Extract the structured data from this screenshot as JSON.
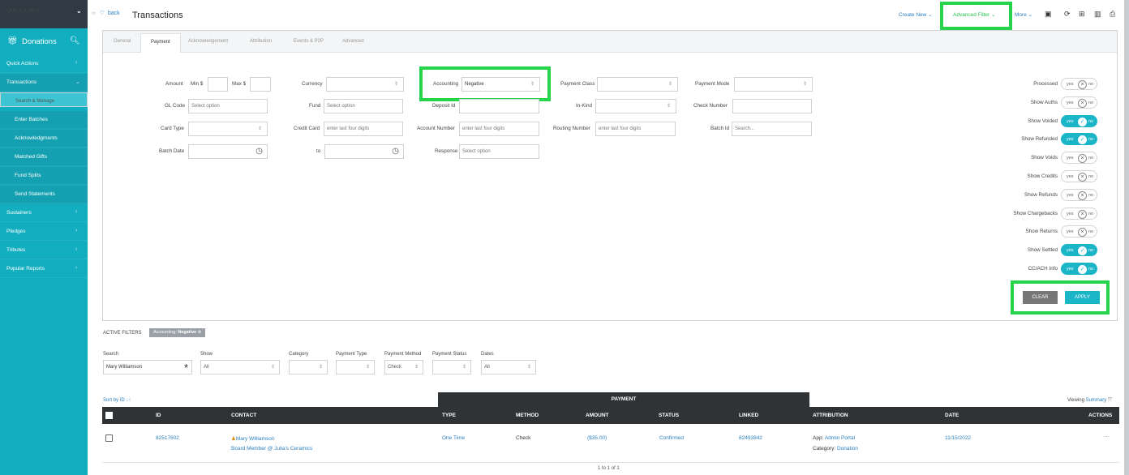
{
  "sidebar": {
    "quick_links": "QUICK LINKS",
    "section": "Donations",
    "items": [
      {
        "label": "Quick Actions",
        "chev": "›"
      },
      {
        "label": "Transactions",
        "chev": "⌄"
      },
      {
        "label": "Search & Manage"
      },
      {
        "label": "Enter Batches"
      },
      {
        "label": "Acknowledgments"
      },
      {
        "label": "Matched Gifts"
      },
      {
        "label": "Fund Splits"
      },
      {
        "label": "Send Statements"
      },
      {
        "label": "Sustainers",
        "chev": "›"
      },
      {
        "label": "Pledges",
        "chev": "›"
      },
      {
        "label": "Tributes",
        "chev": "›"
      },
      {
        "label": "Popular Reports",
        "chev": "›"
      }
    ]
  },
  "header": {
    "back": "back",
    "title": "Transactions",
    "create_new": "Create New ⌄",
    "advanced_filter": "Advanced Filter ⌄",
    "more": "More ⌄"
  },
  "tabs": [
    "General",
    "Payment",
    "Acknowledgement",
    "Attribution",
    "Events & P2P",
    "Advanced"
  ],
  "filters": {
    "amount": "Amount",
    "min": "Min $",
    "max": "Max $",
    "currency": "Currency",
    "accounting": "Accounting",
    "accounting_value": "Negative",
    "payment_class": "Payment Class",
    "payment_mode": "Payment Mode",
    "gl_code": "GL Code",
    "gl_code_ph": "Select option",
    "fund": "Fund",
    "fund_ph": "Select option",
    "deposit_id": "Deposit Id",
    "in_kind": "In-Kind",
    "check_number": "Check Number",
    "card_type": "Card Type",
    "credit_card": "Credit Card",
    "credit_card_ph": "enter last four digits",
    "account_number": "Account Number",
    "account_number_ph": "enter last four digits",
    "routing_number": "Routing Number",
    "routing_number_ph": "enter last four digits",
    "batch_id": "Batch Id",
    "batch_id_ph": "Search...",
    "batch_date": "Batch Date",
    "to": "to",
    "response": "Response",
    "response_ph": "Select option"
  },
  "toggles": [
    {
      "label": "Processed",
      "on": false
    },
    {
      "label": "Show Auths",
      "on": false
    },
    {
      "label": "Show Voided",
      "on": true
    },
    {
      "label": "Show Refunded",
      "on": true
    },
    {
      "label": "Show Voids",
      "on": false
    },
    {
      "label": "Show Credits",
      "on": false
    },
    {
      "label": "Show Refunds",
      "on": false
    },
    {
      "label": "Show Chargebacks",
      "on": false
    },
    {
      "label": "Show Returns",
      "on": false
    },
    {
      "label": "Show Settled",
      "on": true
    },
    {
      "label": "CC/ACH Info",
      "on": true
    }
  ],
  "toggle_yes": "yes",
  "toggle_no": "no",
  "buttons": {
    "clear": "CLEAR",
    "apply": "APPLY"
  },
  "active_filters": {
    "label": "ACTIVE FILTERS",
    "chip_key": "Accounting:",
    "chip_value": "Negative"
  },
  "search_bar": {
    "search_label": "Search",
    "search_value": "Mary Williamson",
    "show_label": "Show",
    "show_value": "All",
    "category_label": "Category",
    "payment_type_label": "Payment Type",
    "payment_method_label": "Payment Method",
    "payment_method_value": "Check",
    "payment_status_label": "Payment Status",
    "dates_label": "Dates",
    "dates_value": "All"
  },
  "grid": {
    "sort_by": "Sort by ID ↓↑",
    "group_header": "PAYMENT",
    "viewing": "Viewing",
    "viewing_mode": "Summary",
    "columns": [
      "ID",
      "CONTACT",
      "TYPE",
      "METHOD",
      "AMOUNT",
      "STATUS",
      "LINKED",
      "ATTRIBUTION",
      "DATE",
      "ACTIONS"
    ],
    "row": {
      "id": "82517602",
      "contact": "Mary Williamson",
      "contact_sub": "Board Member @ Julia's Ceramics",
      "type": "One Time",
      "method": "Check",
      "amount": "($35.00)",
      "status": "Confirmed",
      "linked": "82493842",
      "attr_app_key": "App:",
      "attr_app": "Admin Portal",
      "attr_cat_key": "Category:",
      "attr_cat": "Donation",
      "date": "11/15/2022",
      "actions": "···"
    },
    "pagination": "1 to 1 of 1"
  },
  "colors": {
    "sidebar": "#12aebf",
    "accent": "#1bb5c8",
    "highlight": "#25d44a",
    "link": "#2a7fc0"
  }
}
